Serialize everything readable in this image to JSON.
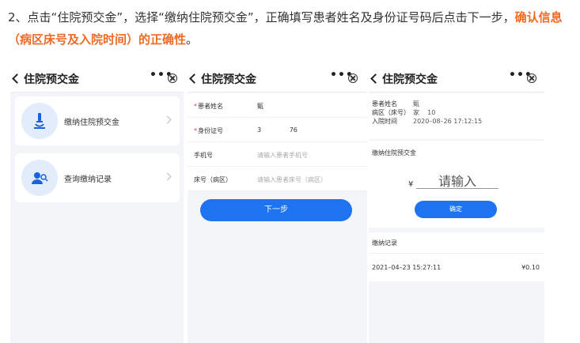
{
  "intro": {
    "text": "2、点击“住院预交金”，选择“缴纳住院预交金”，正确填写患者姓名及身份证号码后点击下一步，",
    "highlight": "确认信息（病区床号及入院时间）的正确性",
    "end": "。"
  },
  "screen1": {
    "title": "住院预交金",
    "items": [
      {
        "label": "缴纳住院预交金",
        "icon": "microscope-icon"
      },
      {
        "label": "查询缴纳记录",
        "icon": "user-search-icon"
      }
    ]
  },
  "screen2": {
    "title": "住院预交金",
    "fields": [
      {
        "label": "患者姓名",
        "required": true,
        "value": "甄",
        "placeholder": ""
      },
      {
        "label": "身份证号",
        "required": true,
        "value": "3              76",
        "placeholder": ""
      },
      {
        "label": "手机号",
        "required": false,
        "value": "",
        "placeholder": "请输入患者手机号"
      },
      {
        "label": "床号（病区）",
        "required": false,
        "value": "",
        "placeholder": "请输入患者床号（病区）"
      }
    ],
    "next_label": "下一步"
  },
  "screen3": {
    "title": "住院预交金",
    "info": [
      {
        "k": "患者姓名",
        "v": "甄"
      },
      {
        "k": "病区（床号）",
        "v": "家    10"
      },
      {
        "k": "入院时间",
        "v": "2020–08–26 17:12:15"
      }
    ],
    "pay_title": "缴纳住院预交金",
    "currency": "¥",
    "amount_placeholder": "请输入",
    "confirm_label": "确定",
    "records_title": "缴纳记录",
    "record_date": "2021–04–23 15:27:11",
    "record_amount": "¥0.10"
  },
  "colors": {
    "accent": "#1e74f0",
    "highlight": "#f06a25"
  }
}
